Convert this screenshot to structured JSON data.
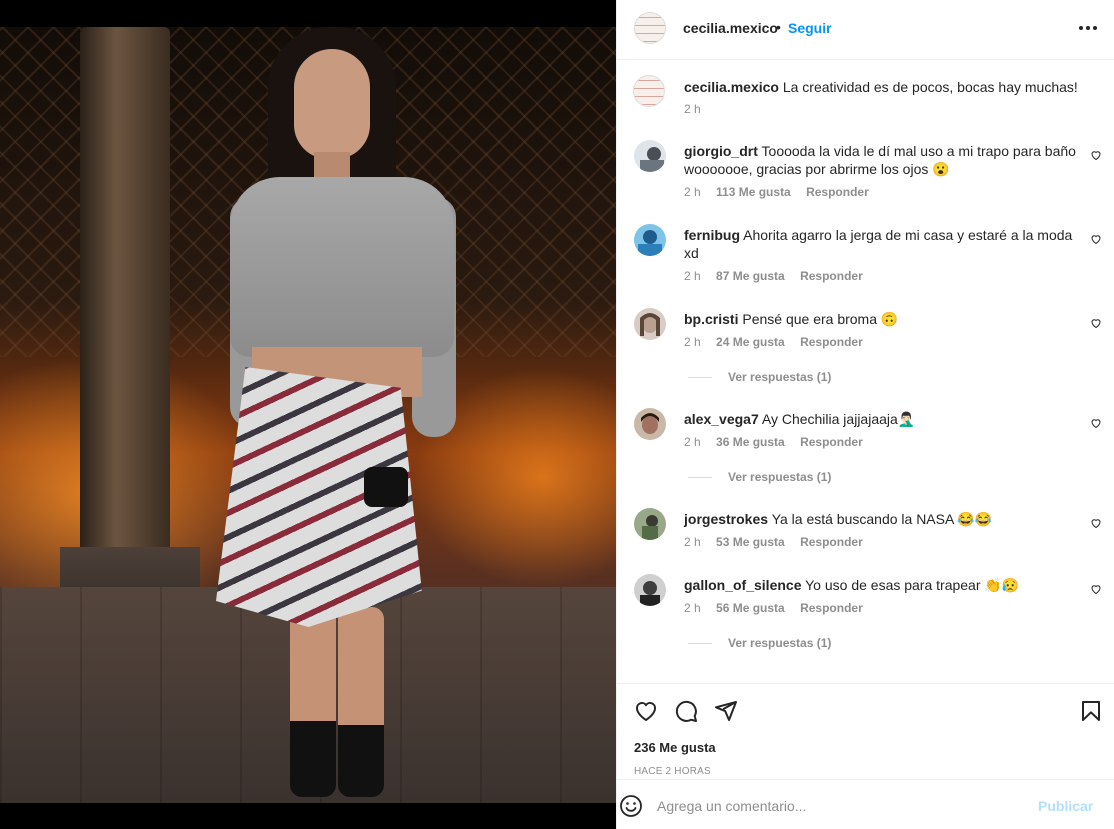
{
  "post": {
    "username": "cecilia.mexico",
    "separator": "•",
    "follow_label": "Seguir"
  },
  "caption": {
    "username": "cecilia.mexico",
    "text": "La creatividad es de pocos, bocas hay muchas!",
    "time": "2 h"
  },
  "comments": [
    {
      "username": "giorgio_drt",
      "text": "Tooooda la vida le dí mal uso a mi trapo para baño wooooooe, gracias por abrirme los ojos 😮",
      "time": "2 h",
      "likes": "113 Me gusta",
      "reply": "Responder",
      "avatar_color": "#7a8a94"
    },
    {
      "username": "fernibug",
      "text": "Ahorita agarro la jerga de mi casa y estaré a la moda xd",
      "time": "2 h",
      "likes": "87 Me gusta",
      "reply": "Responder",
      "avatar_color": "#2c7fb8"
    },
    {
      "username": "bp.cristi",
      "text": "Pensé que era broma 🙃",
      "time": "2 h",
      "likes": "24 Me gusta",
      "reply": "Responder",
      "avatar_color": "#b9a9a0",
      "view_replies": "Ver respuestas (1)"
    },
    {
      "username": "alex_vega7",
      "text": "Ay Chechilia jajjajaaja🤦🏻‍♂️",
      "time": "2 h",
      "likes": "36 Me gusta",
      "reply": "Responder",
      "avatar_color": "#6b4a3a",
      "view_replies": "Ver respuestas (1)"
    },
    {
      "username": "jorgestrokes",
      "text": "Ya la está buscando la NASA 😂😂",
      "time": "2 h",
      "likes": "53 Me gusta",
      "reply": "Responder",
      "avatar_color": "#556b48"
    },
    {
      "username": "gallon_of_silence",
      "text": "Yo uso de esas para trapear 👏😥",
      "time": "2 h",
      "likes": "56 Me gusta",
      "reply": "Responder",
      "avatar_color": "#3d3d3d",
      "view_replies": "Ver respuestas (1)"
    }
  ],
  "actions": {
    "likes": "236 Me gusta",
    "time": "HACE 2 HORAS"
  },
  "composer": {
    "placeholder": "Agrega un comentario...",
    "publish_label": "Publicar"
  },
  "colors": {
    "accent": "#0095f6",
    "publish_disabled": "#b2dffc",
    "muted": "#8e8e8e"
  }
}
